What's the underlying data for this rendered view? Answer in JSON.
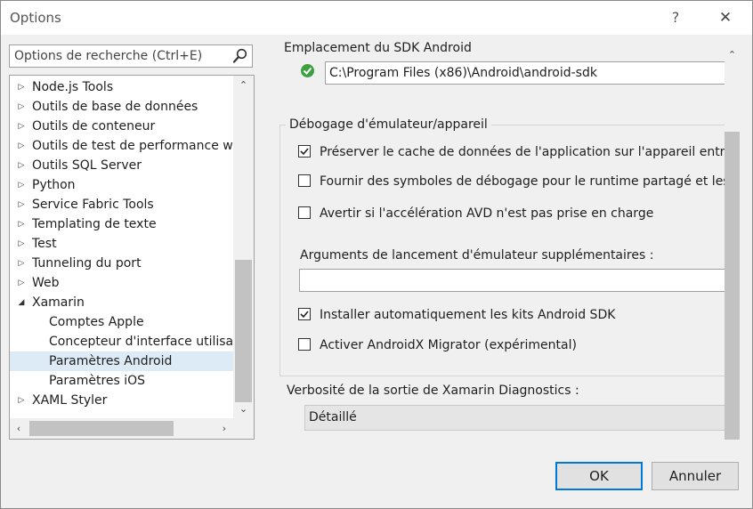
{
  "window": {
    "title": "Options",
    "help_label": "?",
    "close_label": "✕"
  },
  "search": {
    "placeholder": "Options de recherche (Ctrl+E)"
  },
  "tree": {
    "items": [
      {
        "label": "Node.js Tools",
        "arrow": "▷"
      },
      {
        "label": "Outils de base de données",
        "arrow": "▷"
      },
      {
        "label": "Outils de conteneur",
        "arrow": "▷"
      },
      {
        "label": "Outils de test de performance web",
        "arrow": "▷"
      },
      {
        "label": "Outils SQL Server",
        "arrow": "▷"
      },
      {
        "label": "Python",
        "arrow": "▷"
      },
      {
        "label": "Service Fabric Tools",
        "arrow": "▷"
      },
      {
        "label": "Templating de texte",
        "arrow": "▷"
      },
      {
        "label": "Test",
        "arrow": "▷"
      },
      {
        "label": "Tunneling du port",
        "arrow": "▷"
      },
      {
        "label": "Web",
        "arrow": "▷"
      },
      {
        "label": "Xamarin",
        "arrow": "◢"
      },
      {
        "label": "Comptes Apple"
      },
      {
        "label": "Concepteur d'interface utilisateur"
      },
      {
        "label": "Paramètres Android",
        "selected": true
      },
      {
        "label": "Paramètres iOS"
      },
      {
        "label": "XAML Styler",
        "arrow": "▷"
      }
    ],
    "scroll_up": "⌃",
    "scroll_down": "⌄",
    "scroll_left": "‹",
    "scroll_right": "›"
  },
  "content": {
    "sdk_label": "Emplacement du SDK Android",
    "sdk_path": "C:\\Program Files (x86)\\Android\\android-sdk",
    "group_title": "Débogage d'émulateur/appareil",
    "checkboxes": [
      {
        "label": "Préserver le cache de données de l'application sur l'appareil entre les",
        "checked": true
      },
      {
        "label": "Fournir des symboles de débogage pour le runtime partagé et les bibliothèques",
        "checked": false
      },
      {
        "label": "Avertir si l'accélération AVD n'est pas prise en charge",
        "checked": false
      }
    ],
    "args_label": "Arguments de lancement d'émulateur supplémentaires :",
    "args_value": "",
    "checkboxes2": [
      {
        "label": "Installer automatiquement les kits Android SDK",
        "checked": true
      },
      {
        "label": "Activer AndroidX Migrator (expérimental)",
        "checked": false
      }
    ],
    "verbosity_label": "Verbosité de la sortie de Xamarin Diagnostics :",
    "verbosity_value": "Détaillé",
    "scroll_up": "⌃"
  },
  "buttons": {
    "ok": "OK",
    "cancel": "Annuler"
  },
  "colors": {
    "accent": "#0078d7",
    "selection": "#ddebf7",
    "ok_icon": "#3c9f40"
  }
}
